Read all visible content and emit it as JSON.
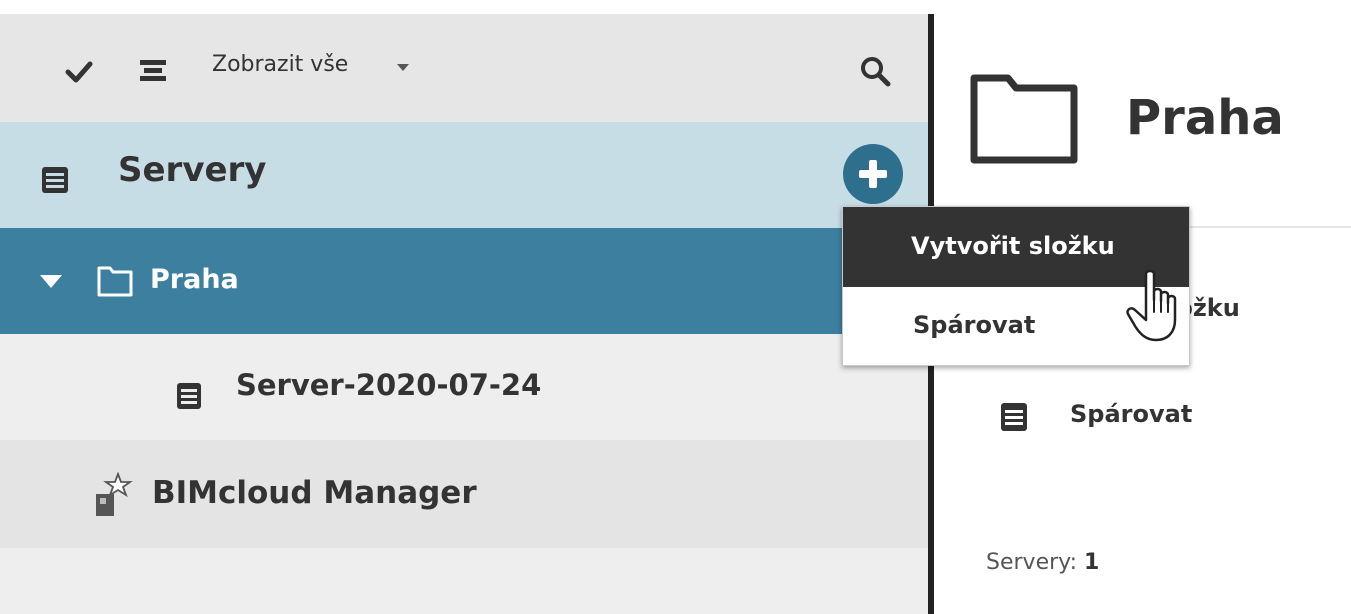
{
  "toolbar": {
    "show_all_label": "Zobrazit vše",
    "icons": [
      "check-icon",
      "filter-icon",
      "chevron-down-icon",
      "search-icon"
    ]
  },
  "tree": {
    "root_label": "Servery",
    "folder_label": "Praha",
    "server_label": "Server-2020-07-24",
    "manager_label": "BIMcloud Manager"
  },
  "add_menu": {
    "items": [
      {
        "label": "Vytvořit složku"
      },
      {
        "label": "Spárovat"
      }
    ]
  },
  "detail": {
    "title": "Praha",
    "create_folder_partial": "t složku",
    "pair_label": "Spárovat",
    "stats_label": "Servery:",
    "stats_value": "1"
  },
  "colors": {
    "selected_row": "#3d7f9e",
    "root_row": "#c6dde6",
    "add_button": "#2f6f8e",
    "menu_hover": "#333333"
  }
}
